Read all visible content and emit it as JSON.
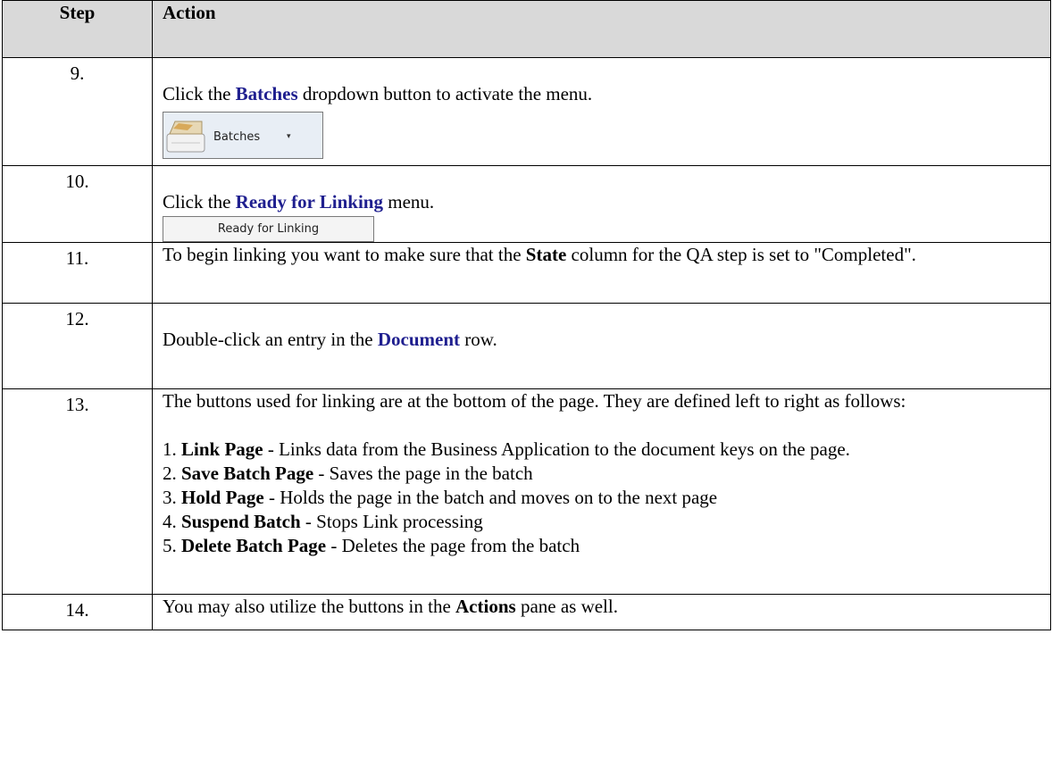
{
  "header": {
    "step": "Step",
    "action": "Action"
  },
  "rows": [
    {
      "num": "9.",
      "pre": "Click the ",
      "kw": "Batches",
      "post": " dropdown button to activate the menu.",
      "button_label": "Batches",
      "button_arrow": "▾"
    },
    {
      "num": "10.",
      "pre": "Click the ",
      "kw": "Ready for Linking",
      "post": " menu.",
      "button_label": "Ready for Linking"
    },
    {
      "num": "11.",
      "pre": "To begin linking you want to make sure that the ",
      "b": "State",
      "post": " column for the QA step is set to \"Completed\"."
    },
    {
      "num": "12.",
      "pre": "Double-click an entry in the ",
      "kw": "Document",
      "post": " row."
    },
    {
      "num": "13.",
      "intro": "The buttons used for linking are at the bottom of the page.  They are defined left to right as follows:",
      "items": [
        {
          "pre": "1.  ",
          "b": "Link Page",
          "post": " - Links data from the Business Application to the document keys on the page."
        },
        {
          "pre": "2. ",
          "b": "Save Batch Page",
          "post": " - Saves the page in the batch"
        },
        {
          "pre": "3.  ",
          "b": "Hold Page",
          "post": " - Holds the page in the batch and moves on to the next page"
        },
        {
          "pre": "4.  ",
          "b": "Suspend Batch",
          "post": " - Stops Link processing"
        },
        {
          "pre": "5. ",
          "b": "Delete Batch Page",
          "post": " - Deletes the page from the batch"
        }
      ]
    },
    {
      "num": "14.",
      "pre": "You may also utilize the buttons in the ",
      "b": "Actions",
      "post": " pane as well."
    }
  ]
}
